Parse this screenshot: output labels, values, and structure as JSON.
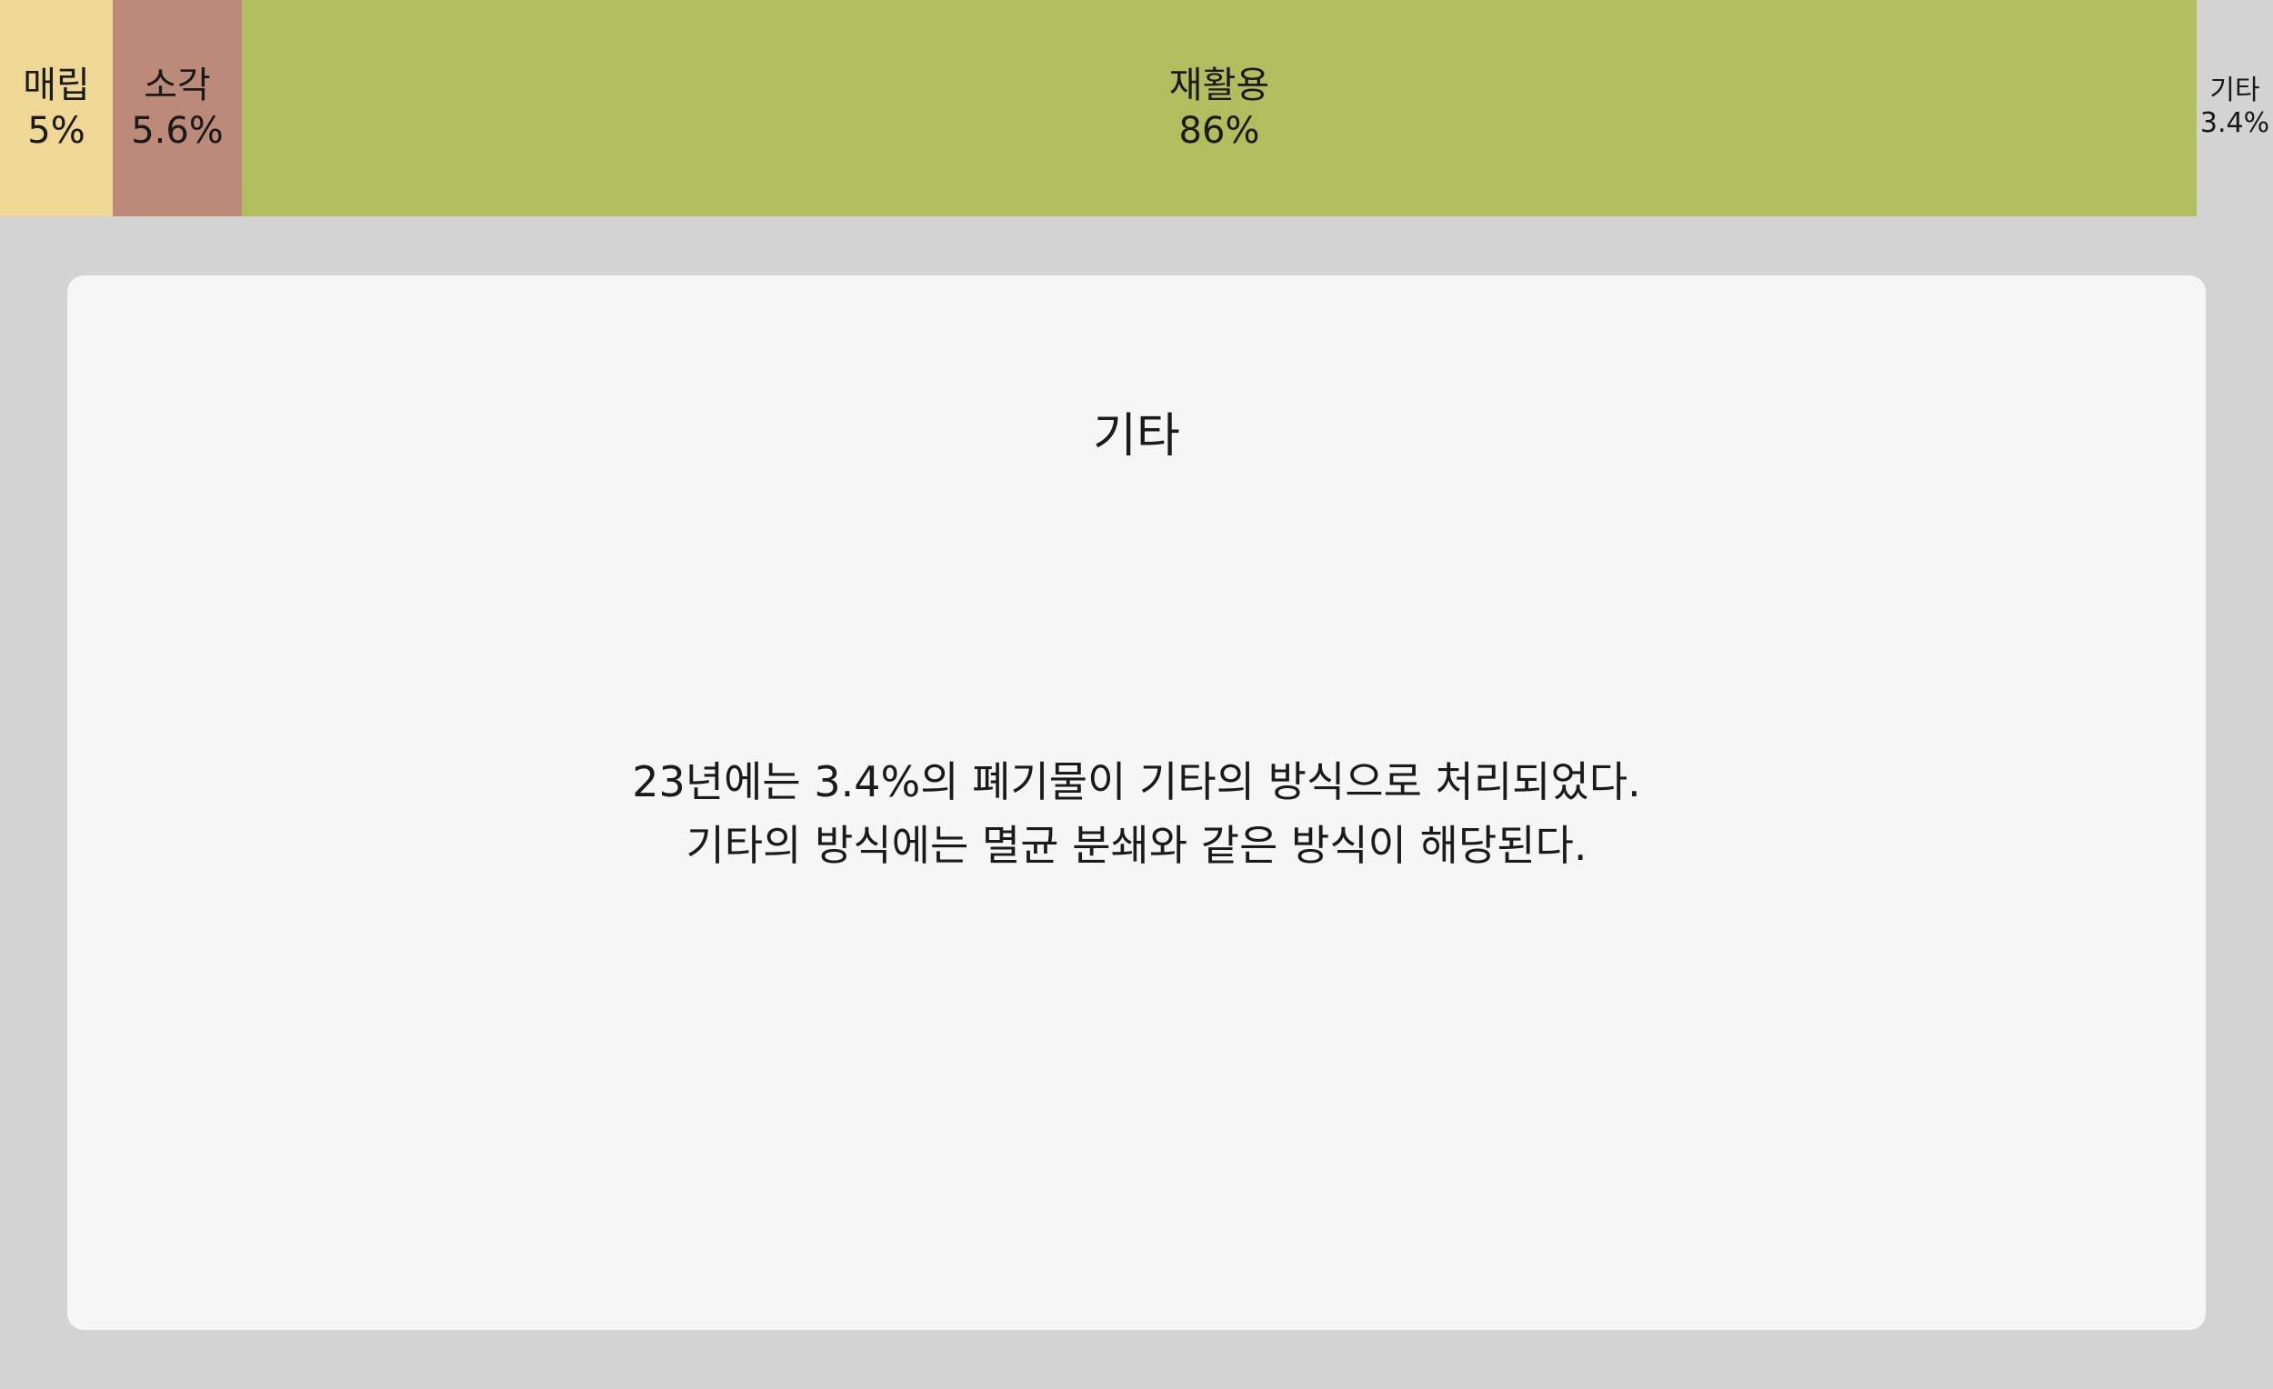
{
  "segments": [
    {
      "label": "매립",
      "percent": "5%",
      "value": 5,
      "color": "#efd796"
    },
    {
      "label": "소각",
      "percent": "5.6%",
      "value": 5.6,
      "color": "#bc8a79"
    },
    {
      "label": "재활용",
      "percent": "86%",
      "value": 86,
      "color": "#b2be5e"
    },
    {
      "label": "기타",
      "percent": "3.4%",
      "value": 3.4,
      "color": "#d3d3d3"
    }
  ],
  "detail": {
    "title": "기타",
    "lines": [
      "23년에는 3.4%의 폐기물이 기타의 방식으로 처리되었다.",
      "기타의 방식에는 멸균 분쇄와 같은 방식이 해당된다."
    ]
  }
}
